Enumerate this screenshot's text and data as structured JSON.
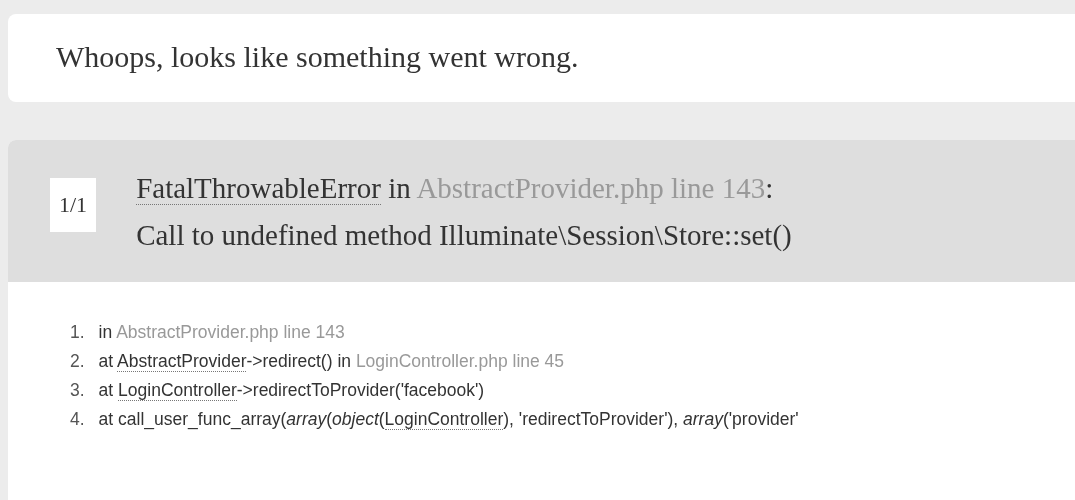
{
  "message": "Whoops, looks like something went wrong.",
  "exception": {
    "count": "1/1",
    "title": [
      {
        "kind": "abbr",
        "text": "FatalThrowableError"
      },
      {
        "kind": "plain",
        "text": " in "
      },
      {
        "kind": "file",
        "text": "AbstractProvider.php line 143"
      },
      {
        "kind": "plain",
        "text": ":"
      }
    ],
    "detail": "Call to undefined method Illuminate\\Session\\Store::set()"
  },
  "trace": [
    {
      "number": "1.",
      "parts": [
        {
          "kind": "plain",
          "text": "in "
        },
        {
          "kind": "file",
          "text": "AbstractProvider.php line 143"
        }
      ]
    },
    {
      "number": "2.",
      "parts": [
        {
          "kind": "plain",
          "text": "at "
        },
        {
          "kind": "abbr",
          "text": "AbstractProvider"
        },
        {
          "kind": "plain",
          "text": "->redirect() in "
        },
        {
          "kind": "file",
          "text": "LoginController.php line 45"
        }
      ]
    },
    {
      "number": "3.",
      "parts": [
        {
          "kind": "plain",
          "text": "at "
        },
        {
          "kind": "abbr",
          "text": "LoginController"
        },
        {
          "kind": "plain",
          "text": "->redirectToProvider('facebook')"
        }
      ]
    },
    {
      "number": "4.",
      "parts": [
        {
          "kind": "plain",
          "text": "at call_user_func_array("
        },
        {
          "kind": "italic",
          "text": "array"
        },
        {
          "kind": "plain",
          "text": "("
        },
        {
          "kind": "italic",
          "text": "object"
        },
        {
          "kind": "plain",
          "text": "("
        },
        {
          "kind": "abbr",
          "text": "LoginController"
        },
        {
          "kind": "plain",
          "text": "), 'redirectToProvider'), "
        },
        {
          "kind": "italic",
          "text": "array"
        },
        {
          "kind": "plain",
          "text": "('provider'"
        }
      ]
    }
  ]
}
